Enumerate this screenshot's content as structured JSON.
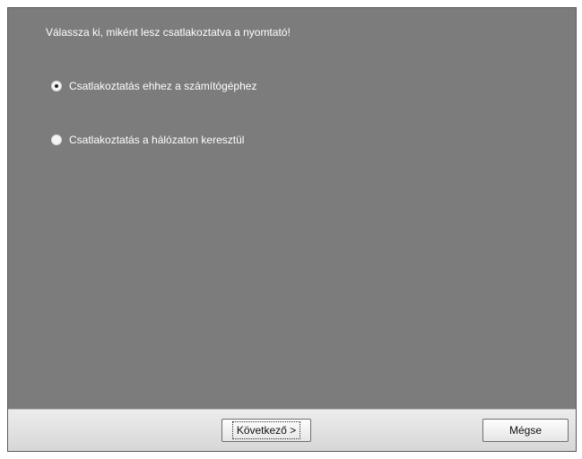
{
  "prompt": "Válassza ki, miként lesz csatlakoztatva a nyomtató!",
  "options": [
    {
      "label": "Csatlakoztatás ehhez a számítógéphez",
      "selected": true
    },
    {
      "label": "Csatlakoztatás a hálózaton keresztül",
      "selected": false
    }
  ],
  "buttons": {
    "next_label": "Következő >",
    "cancel_label": "Mégse"
  }
}
